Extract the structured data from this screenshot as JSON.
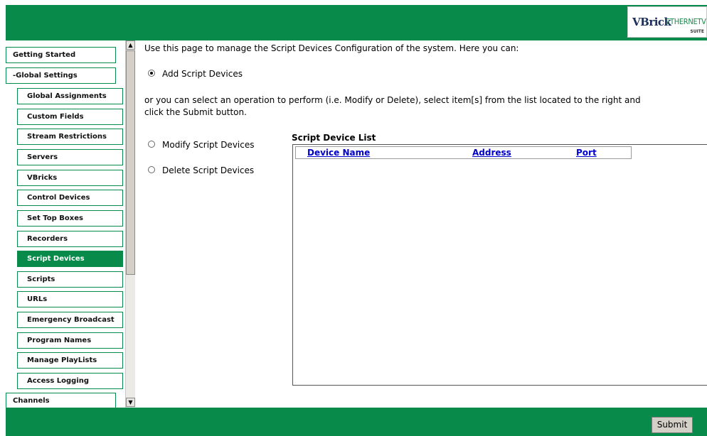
{
  "header": {
    "logo_main": "VBrick",
    "logo_sub": "ETHERNETV",
    "logo_suite": "SUITE"
  },
  "sidebar": {
    "items": [
      {
        "label": "Getting Started",
        "level": 0,
        "active": false
      },
      {
        "label": "-Global Settings",
        "level": 0,
        "active": false
      },
      {
        "label": "Global Assignments",
        "level": 1,
        "active": false
      },
      {
        "label": "Custom Fields",
        "level": 1,
        "active": false
      },
      {
        "label": "Stream Restrictions",
        "level": 1,
        "active": false
      },
      {
        "label": "Servers",
        "level": 1,
        "active": false
      },
      {
        "label": "VBricks",
        "level": 1,
        "active": false
      },
      {
        "label": "Control Devices",
        "level": 1,
        "active": false
      },
      {
        "label": "Set Top Boxes",
        "level": 1,
        "active": false
      },
      {
        "label": "Recorders",
        "level": 1,
        "active": false
      },
      {
        "label": "Script Devices",
        "level": 1,
        "active": true
      },
      {
        "label": "Scripts",
        "level": 1,
        "active": false
      },
      {
        "label": "URLs",
        "level": 1,
        "active": false
      },
      {
        "label": "Emergency Broadcast",
        "level": 1,
        "active": false
      },
      {
        "label": "Program Names",
        "level": 1,
        "active": false
      },
      {
        "label": "Manage PlayLists",
        "level": 1,
        "active": false
      },
      {
        "label": "Access Logging",
        "level": 1,
        "active": false
      },
      {
        "label": "Channels",
        "level": 0,
        "active": false
      }
    ]
  },
  "main": {
    "intro": "Use this page to manage the Script Devices Configuration of the system. Here you can:",
    "add_option": {
      "label": "Add Script Devices",
      "checked": true
    },
    "instructions_line1": "or you can select an operation to perform (i.e. Modify or Delete), select item[s] from the list located to the right and",
    "instructions_line2": "click the Submit button.",
    "modify_option": {
      "label": "Modify Script Devices",
      "checked": false
    },
    "delete_option": {
      "label": "Delete Script Devices",
      "checked": false
    },
    "list": {
      "title": "Script Device List",
      "columns": [
        "Device Name",
        "Address",
        "Port"
      ],
      "rows": []
    }
  },
  "footer": {
    "submit_label": "Submit"
  },
  "colors": {
    "brand_green": "#078a4a",
    "link_blue": "#0000cc"
  }
}
